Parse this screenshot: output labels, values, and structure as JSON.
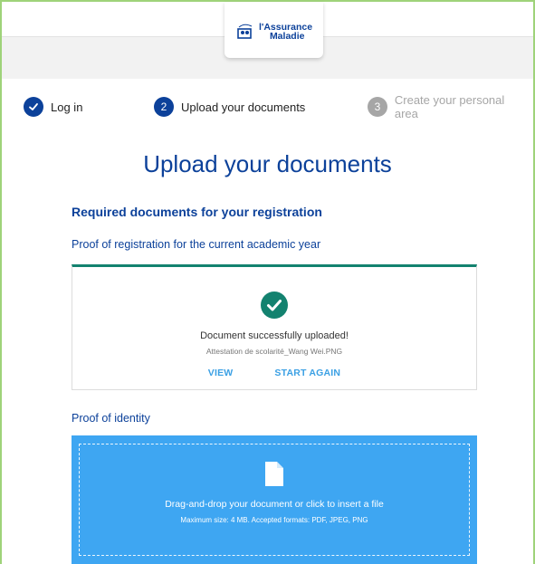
{
  "header": {
    "logo_line1": "l'Assurance",
    "logo_line2": "Maladie"
  },
  "stepper": {
    "steps": [
      {
        "index": "1",
        "label": "Log in",
        "state": "completed"
      },
      {
        "index": "2",
        "label": "Upload your documents",
        "state": "current"
      },
      {
        "index": "3",
        "label": "Create your personal area",
        "state": "upcoming"
      }
    ]
  },
  "main": {
    "title": "Upload your documents",
    "section_title": "Required documents for your registration",
    "documents": [
      {
        "label": "Proof of registration for the current academic year",
        "status": "uploaded",
        "message": "Document successfully uploaded!",
        "file_name": "Attestation de scolarité_Wang Wei.PNG",
        "view_label": "VIEW",
        "restart_label": "START AGAIN"
      },
      {
        "label": "Proof of identity",
        "status": "empty",
        "drop_text": "Drag-and-drop your document or click to insert a file",
        "drop_hint": "Maximum size: 4 MB. Accepted formats: PDF, JPEG, PNG"
      }
    ]
  },
  "colors": {
    "brand": "#0c419a",
    "success": "#13826f",
    "dropzone": "#3ea6f2",
    "link": "#3ba0e4",
    "muted": "#a6a6a6"
  }
}
